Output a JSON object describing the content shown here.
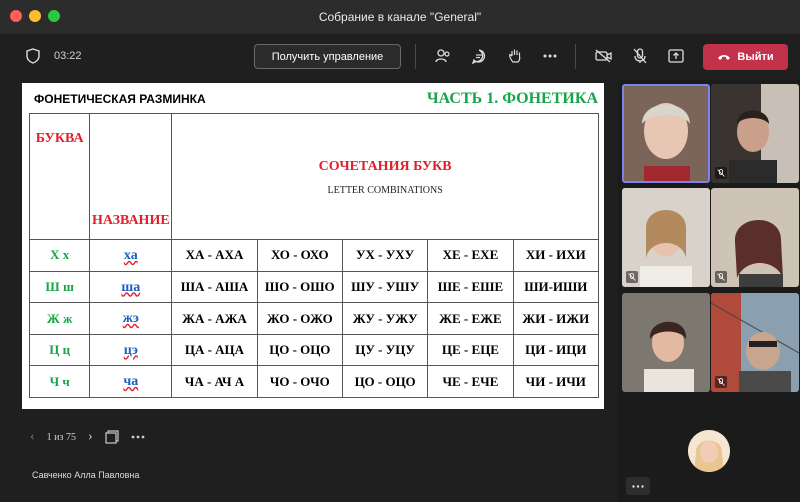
{
  "window": {
    "title": "Собрание в канале \"General\""
  },
  "toolbar": {
    "time": "03:22",
    "request_control": "Получить управление",
    "leave": "Выйти"
  },
  "slide": {
    "title_left": "ФОНЕТИЧЕСКАЯ РАЗМИНКА",
    "title_right": "ЧАСТЬ 1. ФОНЕТИКА",
    "header": {
      "letter": "БУКВА",
      "name": "НАЗВАНИЕ",
      "combinations": "СОЧЕТАНИЯ БУКВ",
      "combinations_en": "LETTER COMBINATIONS"
    },
    "rows": [
      {
        "letter": "Х х",
        "name": "ха",
        "combos": [
          "ХА - АХА",
          "ХО - ОХО",
          "УХ - УХУ",
          "ХЕ - ЕХЕ",
          "ХИ - ИХИ"
        ]
      },
      {
        "letter": "Ш ш",
        "name": "ша",
        "combos": [
          "ША - АША",
          "ШО - ОШО",
          "ШУ - УШУ",
          "ШЕ - ЕШЕ",
          "ШИ-ИШИ"
        ]
      },
      {
        "letter": "Ж ж",
        "name": "жэ",
        "combos": [
          "ЖА - АЖА",
          "ЖО - ОЖО",
          "ЖУ - УЖУ",
          "ЖЕ - ЕЖЕ",
          "ЖИ - ИЖИ"
        ]
      },
      {
        "letter": "Ц ц",
        "name": "цэ",
        "combos": [
          "ЦА - АЦА",
          "ЦО - ОЦО",
          "ЦУ - УЦУ",
          "ЦЕ - ЕЦЕ",
          "ЦИ - ИЦИ"
        ]
      },
      {
        "letter": "Ч ч",
        "name": "ча",
        "combos": [
          "ЧА - АЧ А",
          "ЧО - ОЧО",
          "ЦО - ОЦО",
          "ЧЕ - ЕЧЕ",
          "ЧИ - ИЧИ"
        ]
      }
    ]
  },
  "slide_nav": {
    "page": "1 из 75"
  },
  "presenter": {
    "name": "Савченко Алла Павловна"
  },
  "colors": {
    "leave": "#c4314b",
    "title_green": "#1aa34a",
    "header_red": "#e0202a",
    "name_blue": "#1d5fbf"
  },
  "icons": [
    "shield-icon",
    "people-icon",
    "chat-icon",
    "raise-hand-icon",
    "more-icon",
    "camera-off-icon",
    "mic-off-icon",
    "share-icon",
    "phone-icon"
  ]
}
